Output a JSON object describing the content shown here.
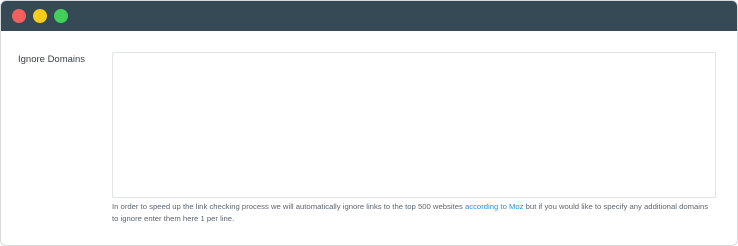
{
  "window": {
    "buttons": [
      {
        "name": "close",
        "color": "#f25f5c"
      },
      {
        "name": "minimize",
        "color": "#f8cb1c"
      },
      {
        "name": "maximize",
        "color": "#42cf5b"
      }
    ],
    "titlebar_color": "#364a56"
  },
  "form": {
    "ignore_domains_label": "Ignore Domains",
    "ignore_domains_value": "",
    "help_text_before": "In order to speed up the link checking process we will automatically ignore links to the top 500 websites ",
    "help_link_text": "according to Moz",
    "help_text_after": " but if you would like to specify any additional domains to ignore enter them here 1 per line."
  },
  "colors": {
    "link": "#2a8fd8"
  }
}
